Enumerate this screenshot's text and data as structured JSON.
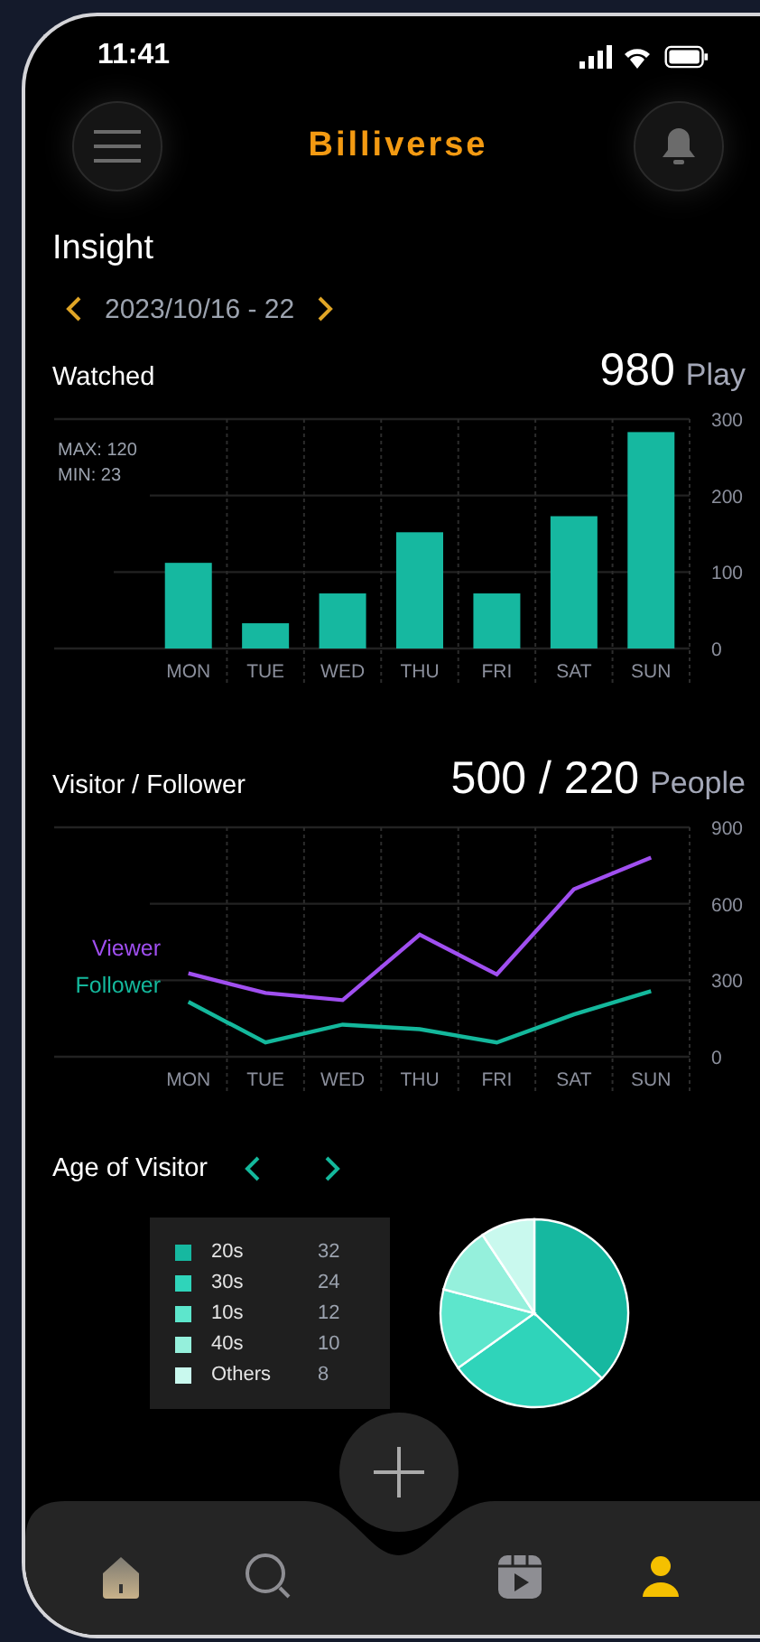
{
  "status_bar": {
    "time": "11:41"
  },
  "header": {
    "title": "Billiverse"
  },
  "page_title": "Insight",
  "date_range": {
    "label": "2023/10/16 - 22"
  },
  "watched": {
    "title": "Watched",
    "total": "980",
    "unit": "Play",
    "notes": [
      "MAX: 120",
      "MIN: 23"
    ],
    "chart_data": {
      "type": "bar",
      "categories": [
        "MON",
        "TUE",
        "WED",
        "THU",
        "FRI",
        "SAT",
        "SUN"
      ],
      "series": [
        {
          "color": "#16b8a0",
          "values": [
            112,
            33,
            72,
            152,
            72,
            173,
            283
          ]
        }
      ],
      "ylim": [
        0,
        300
      ],
      "yticks": [
        0,
        100,
        200,
        300
      ]
    }
  },
  "visitors": {
    "title": "Visitor / Follower",
    "total": "500 / 220",
    "unit": "People",
    "chart_data": {
      "type": "line",
      "categories": [
        "MON",
        "TUE",
        "WED",
        "THU",
        "FRI",
        "SAT",
        "SUN"
      ],
      "series": [
        {
          "name": "Viewer",
          "color": "#a04ff0",
          "values": [
            327,
            250,
            222,
            479,
            323,
            657,
            781
          ]
        },
        {
          "name": "Follower",
          "color": "#14b89c",
          "values": [
            215,
            56,
            126,
            108,
            56,
            166,
            257
          ]
        }
      ],
      "ylim": [
        0,
        900
      ],
      "yticks": [
        0,
        300,
        600,
        900
      ]
    }
  },
  "age": {
    "title": "Age of Visitor",
    "legend": [
      {
        "value": "32",
        "color": "#16b8a0"
      },
      {
        "value": "24",
        "color": "#2fd4ba"
      },
      {
        "value": "12",
        "color": "#5de6cc"
      },
      {
        "value": "10",
        "color": "#95f0dc"
      },
      {
        "value": "8",
        "color": "#c9f9ee"
      }
    ],
    "chart_data": {
      "type": "pie",
      "categories": [
        "20s",
        "30s",
        "10s",
        "40s",
        "Others"
      ],
      "series": [
        {
          "values": [
            37.2,
            27.9,
            14.0,
            11.6,
            9.3
          ]
        }
      ]
    }
  },
  "nav": [
    {
      "kind": "home",
      "selected": false
    },
    {
      "kind": "search",
      "selected": false
    },
    {
      "kind": "video",
      "selected": false
    },
    {
      "kind": "profile",
      "selected": true
    }
  ]
}
